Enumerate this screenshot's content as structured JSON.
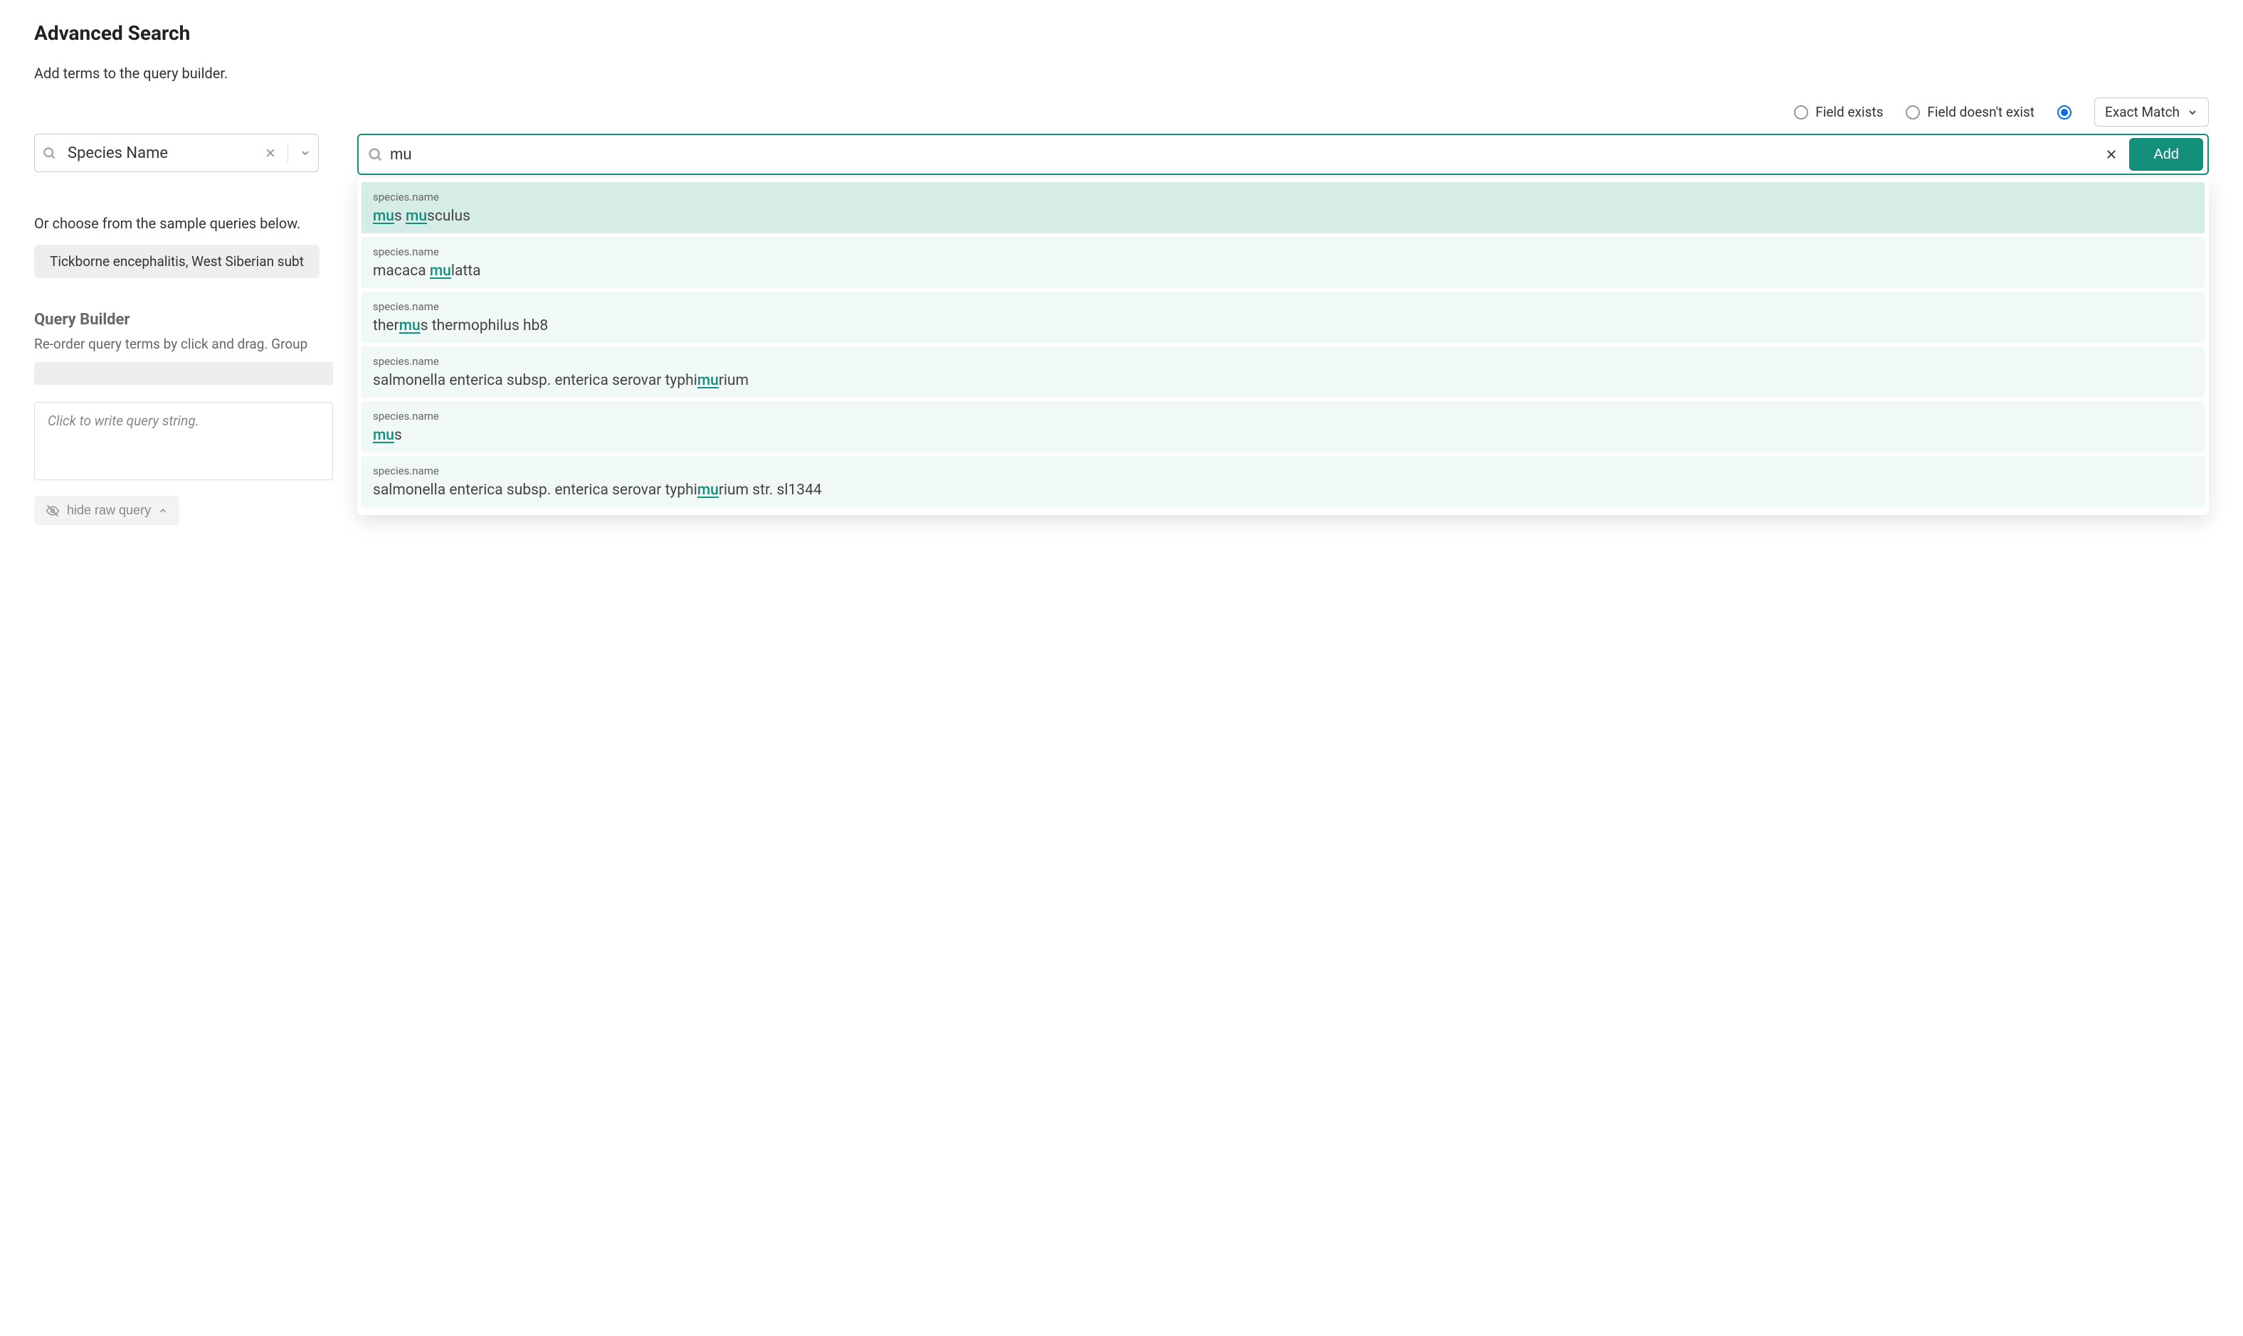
{
  "header": {
    "title": "Advanced Search",
    "sub": "Add terms to the query builder."
  },
  "options": {
    "field_exists": "Field exists",
    "field_not_exists": "Field doesn't exist",
    "match_mode": "Exact Match"
  },
  "field_select": {
    "value": "Species Name"
  },
  "search": {
    "value": "mu",
    "add_label": "Add"
  },
  "suggestions": [
    {
      "label": "species.name",
      "parts": [
        {
          "t": "mu",
          "h": true
        },
        {
          "t": "s ",
          "h": false
        },
        {
          "t": "mu",
          "h": true
        },
        {
          "t": "sculus",
          "h": false
        }
      ],
      "highlighted": true
    },
    {
      "label": "species.name",
      "parts": [
        {
          "t": "macaca ",
          "h": false
        },
        {
          "t": "mu",
          "h": true
        },
        {
          "t": "latta",
          "h": false
        }
      ],
      "highlighted": false
    },
    {
      "label": "species.name",
      "parts": [
        {
          "t": "ther",
          "h": false
        },
        {
          "t": "mu",
          "h": true
        },
        {
          "t": "s thermophilus hb8",
          "h": false
        }
      ],
      "highlighted": false
    },
    {
      "label": "species.name",
      "parts": [
        {
          "t": "salmonella enterica subsp. enterica serovar typhi",
          "h": false
        },
        {
          "t": "mu",
          "h": true
        },
        {
          "t": "rium",
          "h": false
        }
      ],
      "highlighted": false
    },
    {
      "label": "species.name",
      "parts": [
        {
          "t": "mu",
          "h": true
        },
        {
          "t": "s",
          "h": false
        }
      ],
      "highlighted": false
    },
    {
      "label": "species.name",
      "parts": [
        {
          "t": "salmonella enterica subsp. enterica serovar typhi",
          "h": false
        },
        {
          "t": "mu",
          "h": true
        },
        {
          "t": "rium str. sl1344",
          "h": false
        }
      ],
      "highlighted": false
    }
  ],
  "samples": {
    "heading": "Or choose from the sample queries below.",
    "chip": "Tickborne encephalitis, West Siberian subt"
  },
  "query_builder": {
    "heading": "Query Builder",
    "sub": "Re-order query terms by click and drag. Group",
    "placeholder": "Click to write query string.",
    "hide_raw": "hide raw query"
  }
}
